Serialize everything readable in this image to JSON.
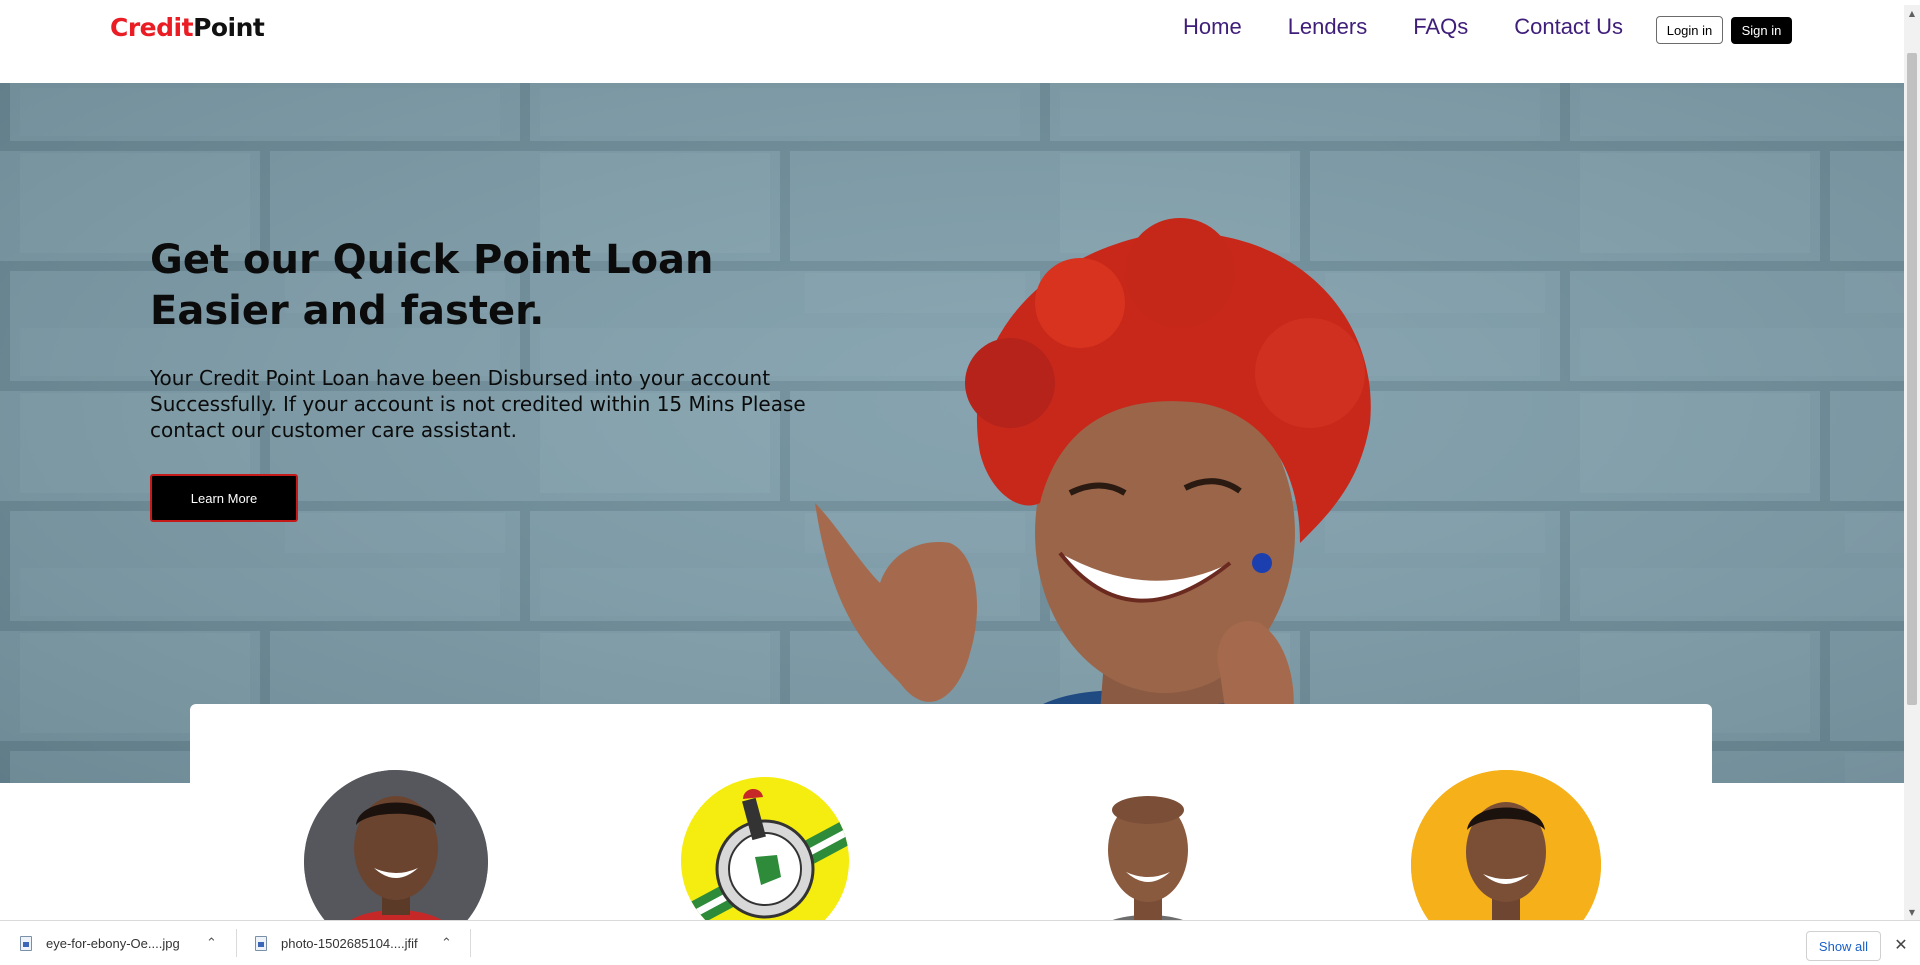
{
  "brand": {
    "part1": "Credit",
    "part2": "Point"
  },
  "nav": {
    "items": [
      "Home",
      "Lenders",
      "FAQs",
      "Contact Us"
    ]
  },
  "auth": {
    "login_label": "Login in",
    "signin_label": "Sign in"
  },
  "hero": {
    "title": "Get our Quick Point Loan Easier and faster.",
    "text": "Your Credit Point Loan have been Disbursed into your account Successfully. If your account is not credited within 15 Mins Please contact our customer care assistant.",
    "button_label": "Learn More"
  },
  "downloads": {
    "files": [
      "eye-for-ebony-Oe....jpg",
      "photo-1502685104....jfif"
    ],
    "show_all_label": "Show all"
  },
  "colors": {
    "brand_red": "#ea1c24",
    "nav_link": "#3f1e7a",
    "show_all": "#1a5fc7"
  },
  "icons": [
    "file-icon",
    "chevron-up-icon",
    "close-icon"
  ]
}
